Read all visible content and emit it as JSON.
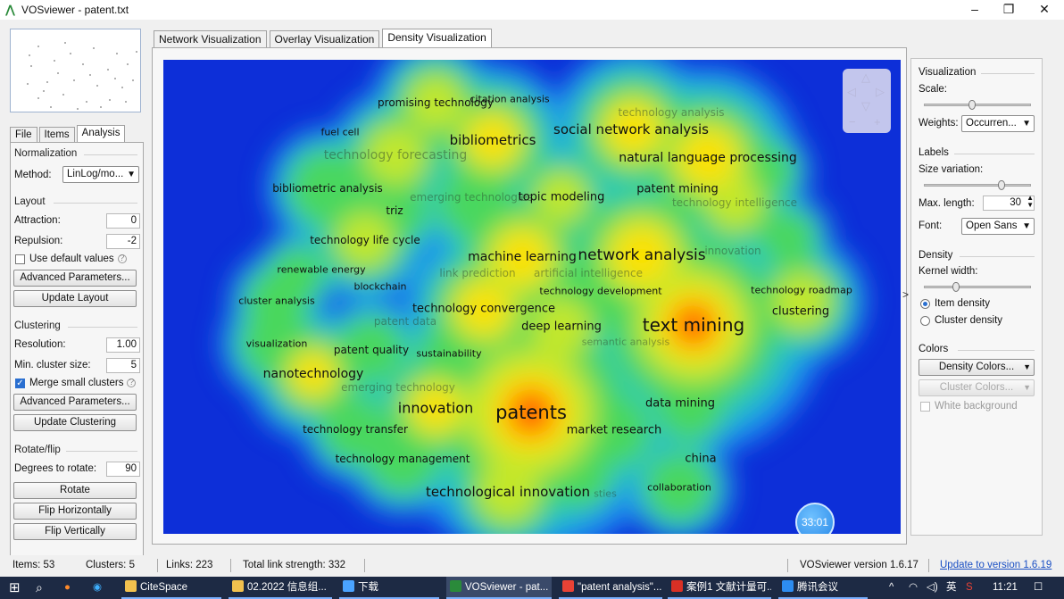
{
  "window": {
    "title": "VOSviewer - patent.txt",
    "minimize_glyph": "‒",
    "restore_glyph": "❐",
    "close_glyph": "✕"
  },
  "left_tabs": [
    "File",
    "Items",
    "Analysis"
  ],
  "analysis": {
    "normalization_heading": "Normalization",
    "method_label": "Method:",
    "method_value": "LinLog/mo...",
    "layout_heading": "Layout",
    "attraction_label": "Attraction:",
    "attraction_value": "0",
    "repulsion_label": "Repulsion:",
    "repulsion_value": "-2",
    "use_default_label": "Use default values",
    "advanced_params_label": "Advanced Parameters...",
    "update_layout_label": "Update Layout",
    "clustering_heading": "Clustering",
    "resolution_label": "Resolution:",
    "resolution_value": "1.00",
    "min_cluster_label": "Min. cluster size:",
    "min_cluster_value": "5",
    "merge_small_label": "Merge small clusters",
    "advanced_params2_label": "Advanced Parameters...",
    "update_clustering_label": "Update Clustering",
    "rotate_heading": "Rotate/flip",
    "degrees_label": "Degrees to rotate:",
    "degrees_value": "90",
    "rotate_label": "Rotate",
    "flip_h_label": "Flip Horizontally",
    "flip_v_label": "Flip Vertically"
  },
  "view_tabs": [
    "Network Visualization",
    "Overlay Visualization",
    "Density Visualization"
  ],
  "map": {
    "timer_label": "33:01",
    "terms": [
      {
        "text": "promising technology",
        "size": 12
      },
      {
        "text": "citation analysis",
        "size": 11
      },
      {
        "text": "fuel cell",
        "size": 11
      },
      {
        "text": "bibliometrics",
        "size": 15
      },
      {
        "text": "social network analysis",
        "size": 15
      },
      {
        "text": "technology analysis",
        "size": 12,
        "faded": true
      },
      {
        "text": "technology forecasting",
        "size": 14,
        "faded": true
      },
      {
        "text": "natural language processing",
        "size": 14
      },
      {
        "text": "bibliometric analysis",
        "size": 12
      },
      {
        "text": "emerging technologies",
        "size": 12,
        "faded": true
      },
      {
        "text": "topic modeling",
        "size": 13
      },
      {
        "text": "patent mining",
        "size": 13
      },
      {
        "text": "technology intelligence",
        "size": 12,
        "faded": true
      },
      {
        "text": "triz",
        "size": 12
      },
      {
        "text": "technology life cycle",
        "size": 12
      },
      {
        "text": "machine learning",
        "size": 14
      },
      {
        "text": "network analysis",
        "size": 17
      },
      {
        "text": "innovation",
        "size": 12,
        "faded": true
      },
      {
        "text": "renewable energy",
        "size": 11
      },
      {
        "text": "link prediction",
        "size": 12,
        "faded": true
      },
      {
        "text": "artificial intelligence",
        "size": 12,
        "faded": true
      },
      {
        "text": "blockchain",
        "size": 11
      },
      {
        "text": "technology development",
        "size": 11
      },
      {
        "text": "technology roadmap",
        "size": 11
      },
      {
        "text": "cluster analysis",
        "size": 11
      },
      {
        "text": "technology convergence",
        "size": 13
      },
      {
        "text": "clustering",
        "size": 13
      },
      {
        "text": "patent data",
        "size": 12,
        "faded": true
      },
      {
        "text": "text mining",
        "size": 20
      },
      {
        "text": "deep learning",
        "size": 13
      },
      {
        "text": "semantic analysis",
        "size": 11,
        "faded": true
      },
      {
        "text": "visualization",
        "size": 11
      },
      {
        "text": "patent quality",
        "size": 12
      },
      {
        "text": "sustainability",
        "size": 11
      },
      {
        "text": "nanotechnology",
        "size": 14
      },
      {
        "text": "emerging technology",
        "size": 12,
        "faded": true
      },
      {
        "text": "innovation",
        "size": 16
      },
      {
        "text": "patents",
        "size": 21
      },
      {
        "text": "data mining",
        "size": 13
      },
      {
        "text": "technology transfer",
        "size": 12
      },
      {
        "text": "market research",
        "size": 13
      },
      {
        "text": "technology management",
        "size": 12
      },
      {
        "text": "china",
        "size": 13
      },
      {
        "text": "technological innovation",
        "size": 15
      },
      {
        "text": "collaboration",
        "size": 11
      },
      {
        "text": "sties",
        "size": 11,
        "faded": true
      }
    ]
  },
  "right_panel": {
    "visualization_heading": "Visualization",
    "scale_label": "Scale:",
    "scale_level": 0.45,
    "weights_label": "Weights:",
    "weights_value": "Occurren...",
    "labels_heading": "Labels",
    "size_variation_label": "Size variation:",
    "size_variation_level": 0.73,
    "max_length_label": "Max. length:",
    "max_length_value": "30",
    "font_label": "Font:",
    "font_value": "Open Sans",
    "density_heading": "Density",
    "kernel_label": "Kernel width:",
    "kernel_level": 0.3,
    "item_density_label": "Item density",
    "cluster_density_label": "Cluster density",
    "colors_heading": "Colors",
    "density_colors_label": "Density Colors...",
    "cluster_colors_label": "Cluster Colors...",
    "white_bg_label": "White background",
    "expand_glyph": ">"
  },
  "status": {
    "items": "Items: 53",
    "clusters": "Clusters: 5",
    "links": "Links: 223",
    "strength": "Total link strength: 332",
    "version": "VOSviewer version 1.6.17",
    "update_link": "Update to version 1.6.19"
  },
  "taskbar": {
    "apps": [
      {
        "label": "CiteSpace",
        "color": "#f2c14e"
      },
      {
        "label": "02.2022 信息组...",
        "color": "#f2c14e"
      },
      {
        "label": "下载",
        "color": "#4aa3ff"
      },
      {
        "label": "VOSviewer - pat...",
        "color": "#2a8a3a"
      },
      {
        "label": "\"patent analysis\"...",
        "color": "#e94235"
      },
      {
        "label": "案例1 文献计量可...",
        "color": "#d93025"
      },
      {
        "label": "腾讯会议",
        "color": "#2d8cf0"
      }
    ],
    "lang": "英",
    "clock": "11:21"
  }
}
